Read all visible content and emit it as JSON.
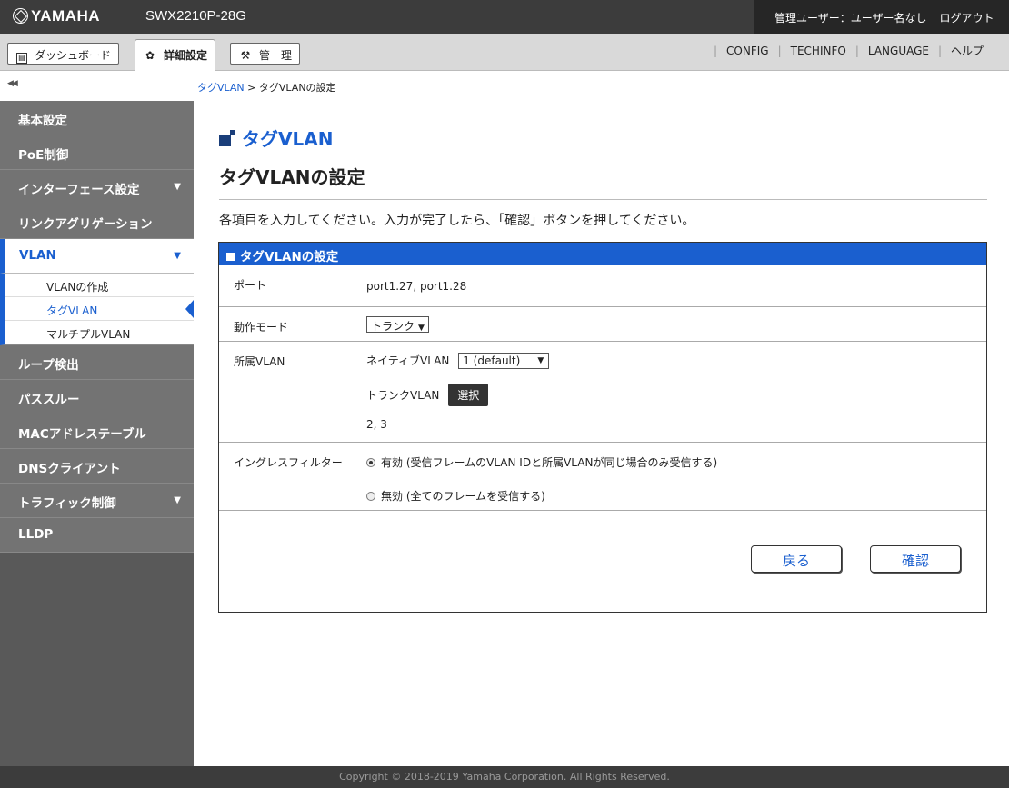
{
  "header": {
    "logo": "YAMAHA",
    "model": "SWX2210P-28G",
    "user": "管理ユーザー：ユーザー名なし",
    "logout": "ログアウト"
  },
  "tabs": [
    {
      "label": "ダッシュボード",
      "icon": "dashboard-icon"
    },
    {
      "label": "詳細設定",
      "icon": "gear-icon"
    },
    {
      "label": "管　理",
      "icon": "wrench-icon"
    }
  ],
  "toplinks": [
    "CONFIG",
    "TECHINFO",
    "LANGUAGE",
    "ヘルプ"
  ],
  "breadcrumb": {
    "link": "タグVLAN",
    "sep": " > ",
    "current": "タグVLANの設定"
  },
  "sidebar": {
    "items": [
      {
        "label": "基本設定"
      },
      {
        "label": "PoE制御"
      },
      {
        "label": "インターフェース設定"
      },
      {
        "label": "リンクアグリゲーション"
      },
      {
        "label": "VLAN"
      },
      {
        "label": "ループ検出"
      },
      {
        "label": "パススルー"
      },
      {
        "label": "MACアドレステーブル"
      },
      {
        "label": "DNSクライアント"
      },
      {
        "label": "トラフィック制御"
      },
      {
        "label": "LLDP"
      }
    ],
    "vlan_sub": [
      "VLANの作成",
      "タグVLAN",
      "マルチプルVLAN"
    ]
  },
  "page": {
    "title": "タグVLAN",
    "section_title": "タグVLANの設定",
    "instruction": "各項目を入力してください。入力が完了したら、「確認」ボタンを押してください。"
  },
  "panel": {
    "title": "タグVLANの設定",
    "port_label": "ポート",
    "port_value": "port1.27, port1.28",
    "mode_label": "動作モード",
    "mode_value": "トランク",
    "vlan_label": "所属VLAN",
    "native_label": "ネイティブVLAN",
    "native_value": "1 (default)",
    "trunk_label": "トランクVLAN",
    "select_button": "選択",
    "trunk_list": "2, 3",
    "ingress_label": "イングレスフィルター",
    "ingress_on": "有効 (受信フレームのVLAN IDと所属VLANが同じ場合のみ受信する)",
    "ingress_off": "無効 (全てのフレームを受信する)",
    "back_button": "戻る",
    "confirm_button": "確認"
  },
  "footer": "Copyright © 2018-2019 Yamaha Corporation. All Rights Reserved.",
  "colors": {
    "accent": "#1a5fcf",
    "topbar": "#3c3c3c",
    "sidebar": "#737373"
  }
}
